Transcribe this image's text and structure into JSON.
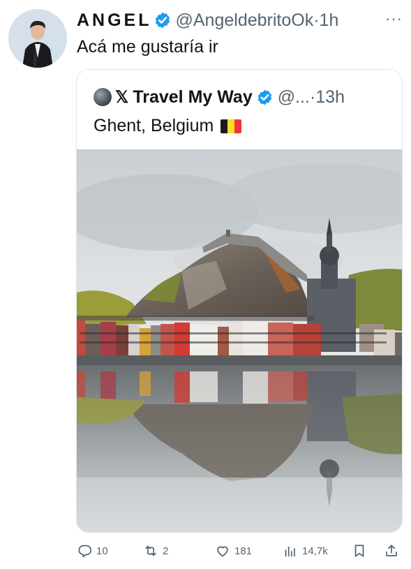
{
  "tweet": {
    "display_name": "ANGEL",
    "handle": "@AngeldebritoOk",
    "separator": "·",
    "time": "1h",
    "more": "···",
    "text": "Acá me gustaría ir",
    "avatar_icon": "person-avatar"
  },
  "quoted": {
    "name": "Travel My Way",
    "handle": "@...",
    "separator": "·",
    "time": "13h",
    "text": "Ghent, Belgium",
    "flag_icon": "belgium-flag",
    "platform_logo": "𝕏",
    "photo_alt": "Town with colorful houses and cathedral under a rocky cliff reflected in a river"
  },
  "actions": {
    "replies": "10",
    "reposts": "2",
    "likes": "181",
    "views": "14,7k"
  },
  "colors": {
    "verified": "#1d9bf0",
    "secondary_text": "#536471"
  }
}
